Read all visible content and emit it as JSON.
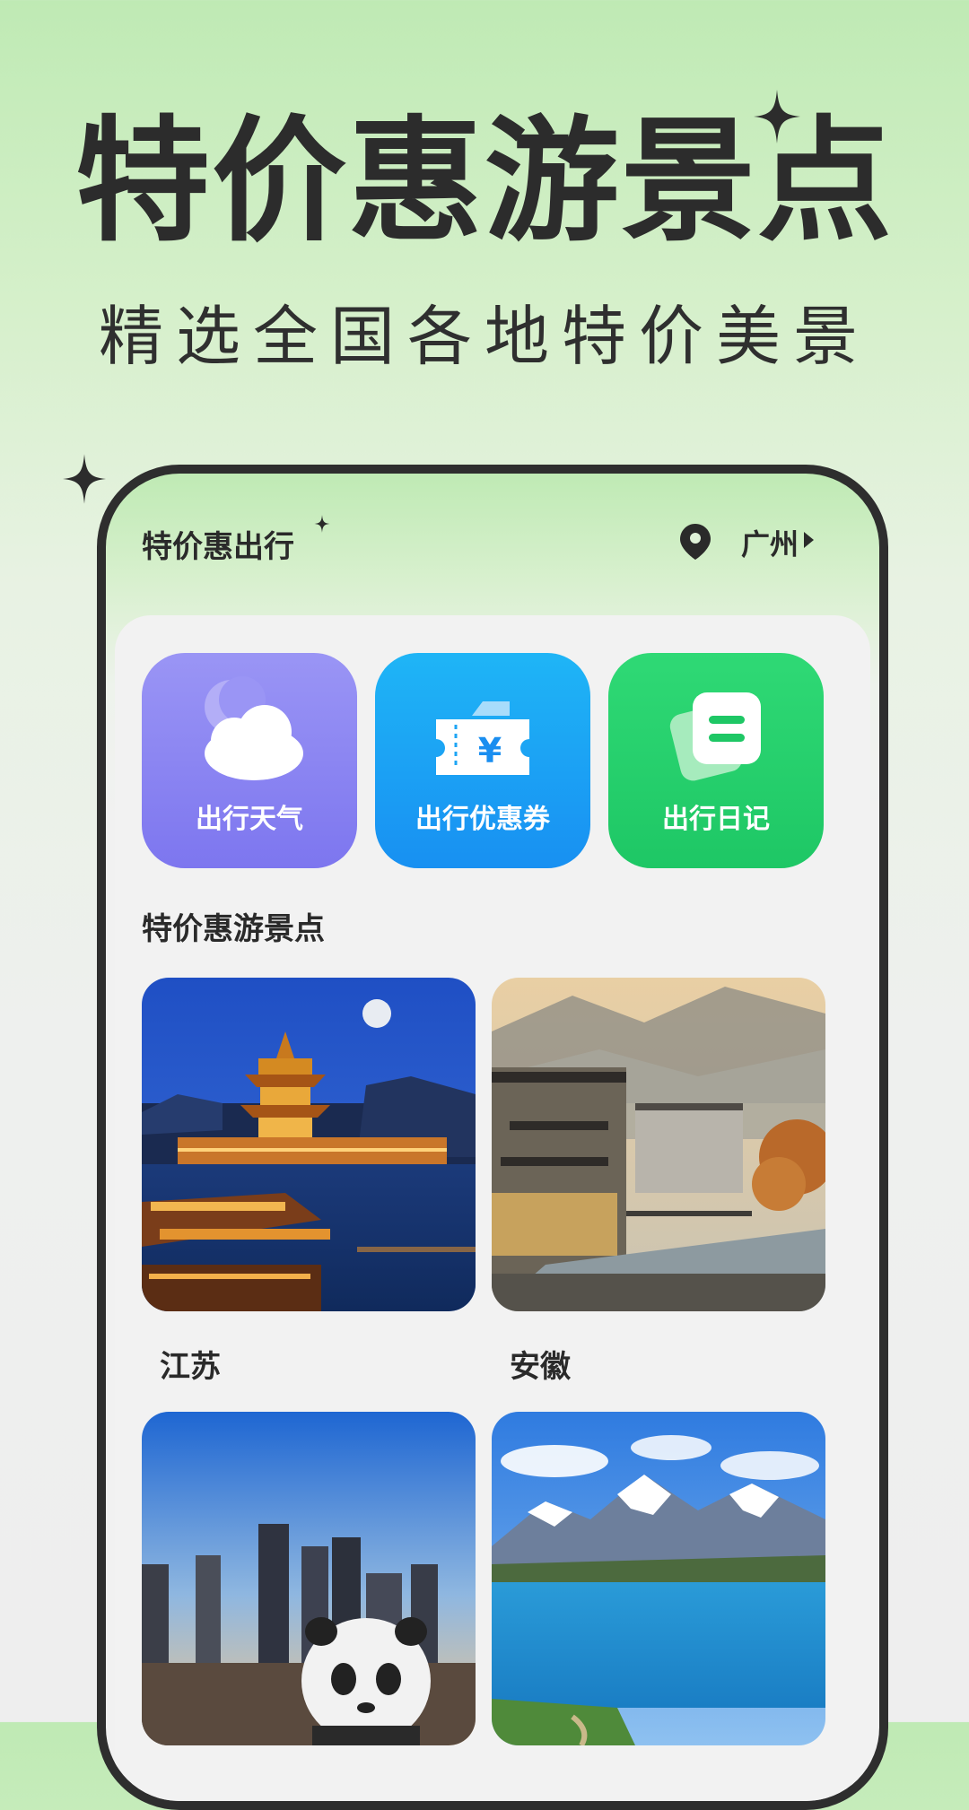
{
  "promo": {
    "headline": "特价惠游景点",
    "subline": "精选全国各地特价美景"
  },
  "app": {
    "title": "特价惠出行",
    "location": "广州"
  },
  "features": [
    {
      "label": "出行天气",
      "icon": "cloud-moon-icon",
      "color": "#7d76ef"
    },
    {
      "label": "出行优惠券",
      "icon": "ticket-yuan-icon",
      "color": "#1890f2"
    },
    {
      "label": "出行日记",
      "icon": "notes-icon",
      "color": "#1ec765"
    }
  ],
  "section": {
    "title": "特价惠游景点"
  },
  "spots": [
    {
      "name": "江苏",
      "image": "night-pagoda-waterfront"
    },
    {
      "name": "安徽",
      "image": "misty-village-bridge"
    },
    {
      "name": "",
      "image": "city-skyline-panda"
    },
    {
      "name": "",
      "image": "snow-mountain-lake"
    }
  ]
}
